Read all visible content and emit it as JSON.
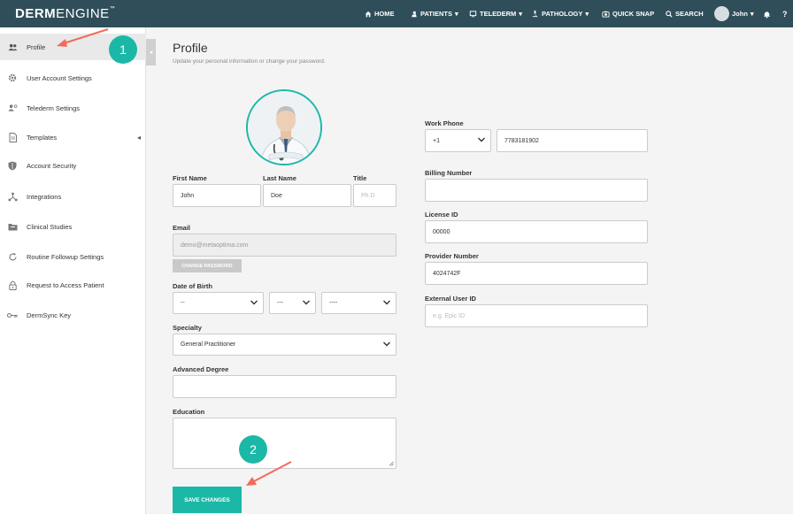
{
  "app": {
    "logo_bold": "DERM",
    "logo_rest": "ENGINE",
    "logo_tm": "™"
  },
  "nav": {
    "home": "HOME",
    "patients": "PATIENTS",
    "telederm": "TELEDERM",
    "pathology": "PATHOLOGY",
    "quick_snap": "QUICK SNAP",
    "search": "SEARCH",
    "user": "John"
  },
  "sidebar": {
    "items": [
      {
        "label": "Profile",
        "icon": "users-icon"
      },
      {
        "label": "User Account Settings",
        "icon": "gear-icon"
      },
      {
        "label": "Telederm Settings",
        "icon": "telederm-icon"
      },
      {
        "label": "Templates",
        "icon": "document-icon"
      },
      {
        "label": "Account Security",
        "icon": "shield-icon"
      },
      {
        "label": "Integrations",
        "icon": "network-icon"
      },
      {
        "label": "Clinical Studies",
        "icon": "folder-icon"
      },
      {
        "label": "Routine Followup Settings",
        "icon": "refresh-icon"
      },
      {
        "label": "Request to Access Patient",
        "icon": "lock-icon"
      },
      {
        "label": "DermSync Key",
        "icon": "key-icon"
      }
    ]
  },
  "main": {
    "title": "Profile",
    "subtitle": "Update your personal information or change your password.",
    "first_name_label": "First Name",
    "first_name": "John",
    "last_name_label": "Last Name",
    "last_name": "Doe",
    "title_label": "Title",
    "title_placeholder": "Ph.D",
    "email_label": "Email",
    "email": "demo@metaoptima.com",
    "change_password": "CHANGE PASSWORD",
    "dob_label": "Date of Birth",
    "dob_day": "--",
    "dob_month": "---",
    "dob_year": "----",
    "specialty_label": "Specialty",
    "specialty": "General Practitioner",
    "advanced_degree_label": "Advanced Degree",
    "education_label": "Education",
    "save": "SAVE CHANGES",
    "work_phone_label": "Work Phone",
    "phone_code": "+1",
    "phone": "7783181902",
    "billing_label": "Billing Number",
    "license_label": "License ID",
    "license": "00000",
    "provider_label": "Provider Number",
    "provider": "4024742F",
    "external_label": "External User ID",
    "external_placeholder": "e.g. Epic ID"
  },
  "annotations": {
    "step1": "1",
    "step2": "2",
    "color": "#1cb8a7",
    "arrow_color": "#f26b5b"
  }
}
